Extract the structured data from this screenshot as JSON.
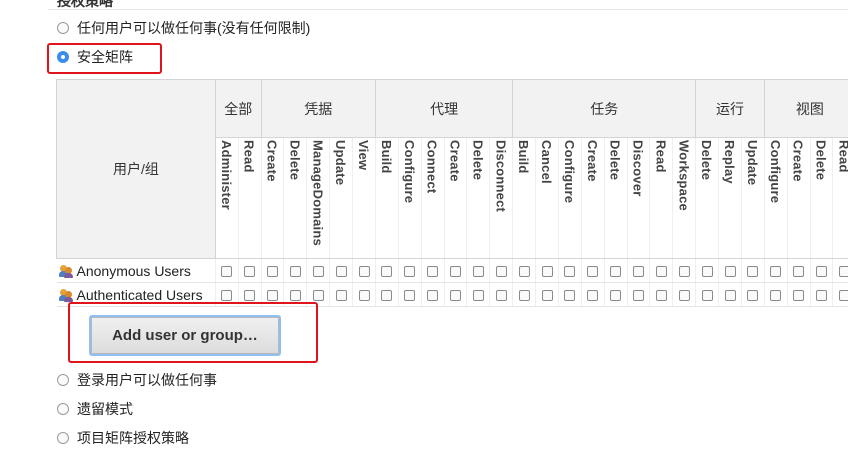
{
  "section_title": "授权策略",
  "strategies": {
    "anyone": "任何用户可以做任何事(没有任何限制)",
    "matrix": "安全矩阵",
    "logged_in": "登录用户可以做任何事",
    "legacy": "遗留模式",
    "project_matrix": "项目矩阵授权策略"
  },
  "selected_strategy": "安全矩阵",
  "matrix": {
    "user_column": "用户/组",
    "groups": [
      {
        "name": "全部",
        "permissions": [
          "Administer",
          "Read"
        ]
      },
      {
        "name": "凭据",
        "permissions": [
          "Create",
          "Delete",
          "ManageDomains",
          "Update",
          "View"
        ]
      },
      {
        "name": "代理",
        "permissions": [
          "Build",
          "Configure",
          "Connect",
          "Create",
          "Delete",
          "Disconnect"
        ]
      },
      {
        "name": "任务",
        "permissions": [
          "Build",
          "Cancel",
          "Configure",
          "Create",
          "Delete",
          "Discover",
          "Read",
          "Workspace"
        ]
      },
      {
        "name": "运行",
        "permissions": [
          "Delete",
          "Replay",
          "Update"
        ]
      },
      {
        "name": "视图",
        "permissions": [
          "Configure",
          "Create",
          "Delete",
          "Read"
        ]
      }
    ],
    "users": [
      {
        "name": "Anonymous Users",
        "icon": "user-group-icon"
      },
      {
        "name": "Authenticated Users",
        "icon": "user-group-icon"
      }
    ]
  },
  "add_button": "Add user or group…",
  "colors": {
    "highlight": "#e0141c",
    "radio_selected": "#3c8cf0",
    "header_bg": "#f2f2f2",
    "button_focus": "#8fc0f3"
  }
}
